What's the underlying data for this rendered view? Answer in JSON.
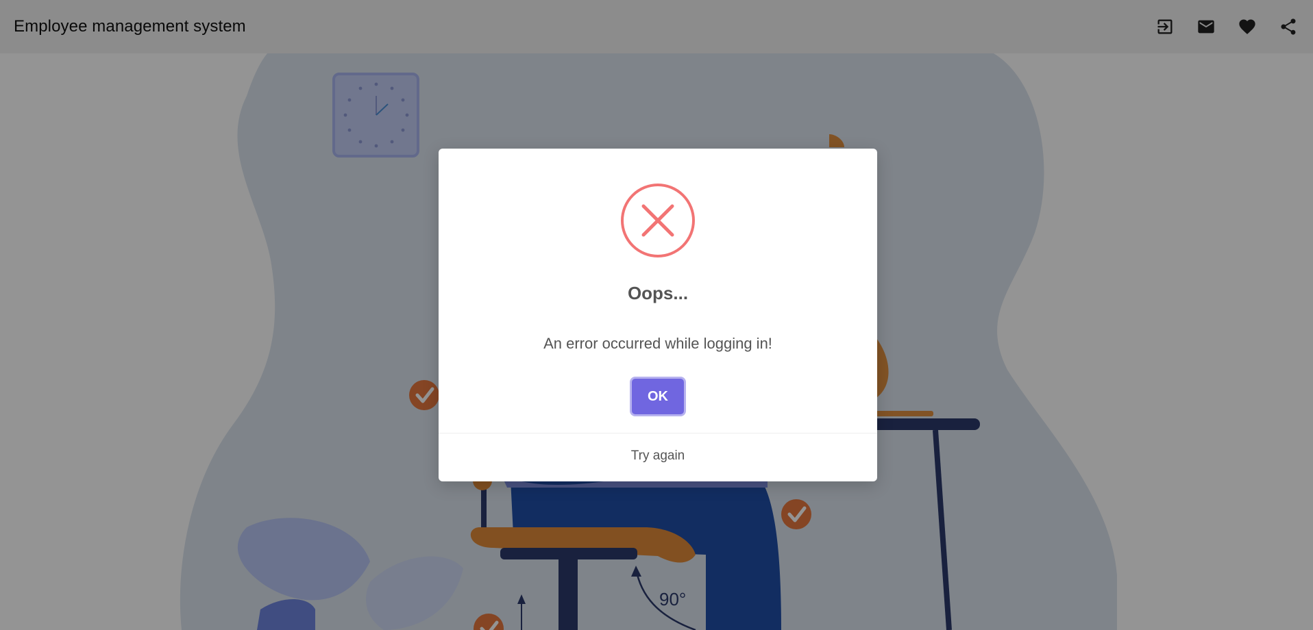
{
  "app": {
    "title": "Employee management system"
  },
  "toolbar": {
    "icons": [
      "login-icon",
      "mail-icon",
      "heart-icon",
      "share-icon"
    ]
  },
  "illustration": {
    "angle_label": "90°"
  },
  "dialog": {
    "icon": "error-x-icon",
    "title": "Oops...",
    "message": "An error occurred while logging in!",
    "ok_label": "OK",
    "footer_link": "Try again",
    "accent_color": "#7066e0",
    "error_color": "#f27474"
  }
}
